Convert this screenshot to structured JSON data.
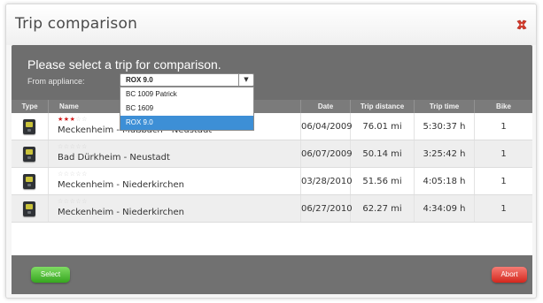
{
  "dialog": {
    "title": "Trip comparison",
    "close_icon": "close-x-icon"
  },
  "panel": {
    "prompt": "Please select a trip for comparison.",
    "from_label": "From appliance:"
  },
  "appliance_select": {
    "value": "ROX 9.0",
    "options": [
      "BC 1009 Patrick",
      "BC 1609",
      "ROX 9.0"
    ],
    "selected_index": 2
  },
  "table": {
    "columns": [
      "Type",
      "Name",
      "Date",
      "Trip distance",
      "Trip time",
      "Bike"
    ],
    "rows": [
      {
        "icon": "bike-computer-icon",
        "stars": 3,
        "name": "Meckenheim - Mußbach - Neustadt",
        "date": "06/04/2009",
        "distance": "76.01 mi",
        "time": "5:30:37 h",
        "bike": "1"
      },
      {
        "icon": "bike-computer-icon",
        "stars": 0,
        "name": "Bad Dürkheim - Neustadt",
        "date": "06/07/2009",
        "distance": "50.14 mi",
        "time": "3:25:42 h",
        "bike": "1"
      },
      {
        "icon": "bike-computer-icon",
        "stars": 0,
        "name": "Meckenheim - Niederkirchen",
        "date": "03/28/2010",
        "distance": "51.56 mi",
        "time": "4:05:18 h",
        "bike": "1"
      },
      {
        "icon": "bike-computer-icon",
        "stars": 0,
        "name": "Meckenheim - Niederkirchen",
        "date": "06/27/2010",
        "distance": "62.27 mi",
        "time": "4:34:09 h",
        "bike": "1"
      }
    ]
  },
  "footer": {
    "select_label": "Select",
    "abort_label": "Abort"
  },
  "colors": {
    "select_button": "#36a51f",
    "abort_button": "#d4271d",
    "star_on": "#d01b1b",
    "close_icon": "#d63a2a",
    "dropdown_highlight": "#3d8fd6"
  }
}
